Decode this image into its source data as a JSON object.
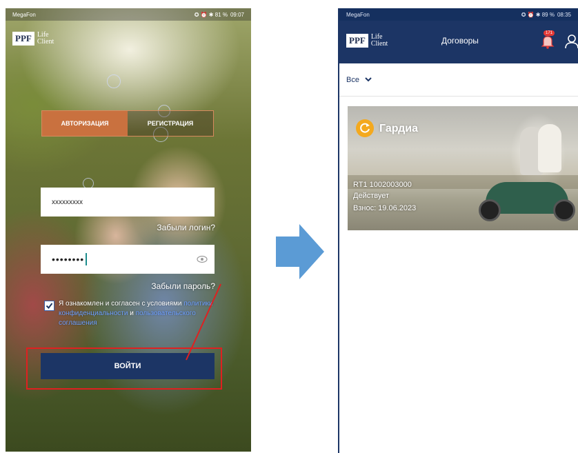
{
  "login_screen": {
    "status_bar": {
      "carrier": "MegaFon",
      "status": "✪ ⏰ ✱ 81 %",
      "time": "09:07"
    },
    "logo": {
      "brand": "PPF",
      "line1": "Life",
      "line2": "Client"
    },
    "tabs": [
      {
        "label": "АВТОРИЗАЦИЯ",
        "active": true
      },
      {
        "label": "РЕГИСТРАЦИЯ",
        "active": false
      }
    ],
    "login_field": {
      "value": "xxxxxxxxx"
    },
    "forgot_login": "Забыли логин?",
    "password_field": {
      "value": "••••••••"
    },
    "forgot_password": "Забыли пароль?",
    "agreement": {
      "checked": true,
      "text1": "Я ознакомлен и согласен с условиями ",
      "link1": "политики конфиденциальности",
      "text2": " и ",
      "link2": "пользовательского соглашения"
    },
    "login_button": "ВОЙТИ",
    "accent_colors": {
      "primary": "#1c3565",
      "tab_active": "#c9713f",
      "highlight": "#e02020"
    }
  },
  "contracts_screen": {
    "status_bar": {
      "carrier": "MegaFon",
      "status": "✪ ⏰ ✱ 89 %",
      "time": "08:35"
    },
    "logo": {
      "brand": "PPF",
      "line1": "Life",
      "line2": "Client"
    },
    "header_title": "Договоры",
    "notifications_badge": "171",
    "filter": {
      "selected": "Все"
    },
    "card": {
      "title": "Гардиа",
      "contract_number": "RT1 1002003000",
      "status": "Действует",
      "payment": "Взнос: 19.06.2023"
    }
  }
}
